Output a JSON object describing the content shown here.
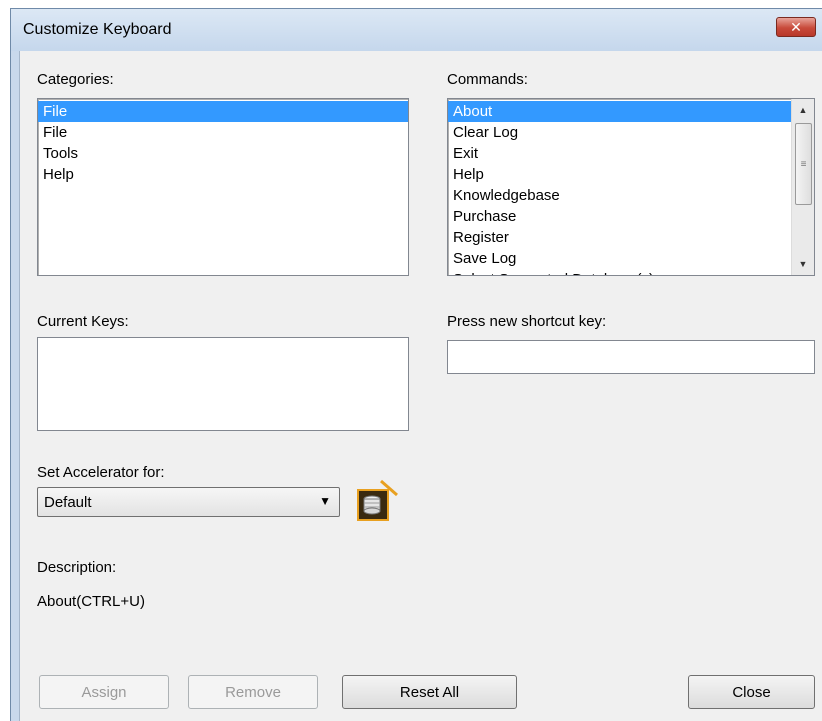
{
  "window": {
    "title": "Customize Keyboard",
    "close_glyph": "✕"
  },
  "labels": {
    "categories": "Categories:",
    "commands": "Commands:",
    "current_keys": "Current Keys:",
    "press_new": "Press new shortcut key:",
    "set_accelerator": "Set Accelerator for:",
    "description": "Description:"
  },
  "categories": {
    "items": [
      "File",
      "File",
      "Tools",
      "Help"
    ],
    "selected_index": 0
  },
  "commands": {
    "items": [
      "About",
      "Clear Log",
      "Exit",
      "Help",
      "Knowledgebase",
      "Purchase",
      "Register",
      "Save Log",
      "Select Supported Database(s)"
    ],
    "selected_index": 0
  },
  "current_keys": {
    "value": ""
  },
  "new_shortcut": {
    "value": ""
  },
  "accelerator": {
    "selected": "Default",
    "icon": "database-icon"
  },
  "description_text": "About(CTRL+U)",
  "buttons": {
    "assign": "Assign",
    "remove": "Remove",
    "reset_all": "Reset All",
    "close": "Close"
  },
  "colors": {
    "selection": "#3399ff",
    "close_button": "#c84a3a",
    "icon_border": "#e8a020"
  }
}
